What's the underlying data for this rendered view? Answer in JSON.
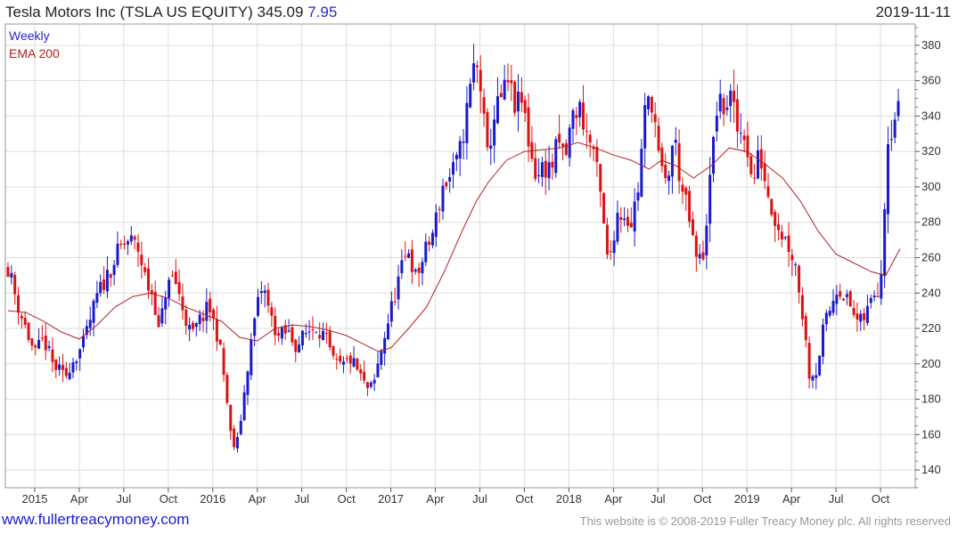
{
  "header": {
    "title": "Tesla Motors Inc (TSLA US EQUITY) 345.09",
    "change": "7.95",
    "date": "2019-11-11"
  },
  "footer": {
    "link": "www.fullertreacymoney.com",
    "copyright": "This website is © 2008-2019 Fuller Treacy Money plc. All rights reserved"
  },
  "chart_data": {
    "type": "candlestick",
    "legend": [
      "Weekly",
      "EMA 200"
    ],
    "colors": {
      "up": "#1a1acc",
      "down": "#dd1111",
      "ema": "#b52020",
      "grid": "#dddddd"
    },
    "ylim": [
      130,
      392
    ],
    "y_ticks": [
      140,
      160,
      180,
      200,
      220,
      240,
      260,
      280,
      300,
      320,
      340,
      360,
      380
    ],
    "x_ticks": [
      {
        "label": "2015",
        "t": 2015.0
      },
      {
        "label": "Apr",
        "t": 2015.25
      },
      {
        "label": "Jul",
        "t": 2015.5
      },
      {
        "label": "Oct",
        "t": 2015.75
      },
      {
        "label": "2016",
        "t": 2016.0
      },
      {
        "label": "Apr",
        "t": 2016.25
      },
      {
        "label": "Jul",
        "t": 2016.5
      },
      {
        "label": "Oct",
        "t": 2016.75
      },
      {
        "label": "2017",
        "t": 2017.0
      },
      {
        "label": "Apr",
        "t": 2017.25
      },
      {
        "label": "Jul",
        "t": 2017.5
      },
      {
        "label": "Oct",
        "t": 2017.75
      },
      {
        "label": "2018",
        "t": 2018.0
      },
      {
        "label": "Apr",
        "t": 2018.25
      },
      {
        "label": "Jul",
        "t": 2018.5
      },
      {
        "label": "Oct",
        "t": 2018.75
      },
      {
        "label": "2019",
        "t": 2019.0
      },
      {
        "label": "Apr",
        "t": 2019.25
      },
      {
        "label": "Jul",
        "t": 2019.5
      },
      {
        "label": "Oct",
        "t": 2019.75
      }
    ],
    "xlim": [
      2014.85,
      2019.9
    ],
    "close_anchors": [
      [
        2014.85,
        255
      ],
      [
        2014.9,
        235
      ],
      [
        2014.95,
        220
      ],
      [
        2015.0,
        205
      ],
      [
        2015.05,
        214
      ],
      [
        2015.1,
        200
      ],
      [
        2015.17,
        192
      ],
      [
        2015.2,
        200
      ],
      [
        2015.27,
        210
      ],
      [
        2015.35,
        238
      ],
      [
        2015.43,
        255
      ],
      [
        2015.48,
        265
      ],
      [
        2015.53,
        270
      ],
      [
        2015.58,
        265
      ],
      [
        2015.63,
        245
      ],
      [
        2015.67,
        238
      ],
      [
        2015.7,
        215
      ],
      [
        2015.73,
        240
      ],
      [
        2015.78,
        250
      ],
      [
        2015.83,
        232
      ],
      [
        2015.88,
        215
      ],
      [
        2015.93,
        225
      ],
      [
        2015.98,
        232
      ],
      [
        2016.03,
        215
      ],
      [
        2016.07,
        188
      ],
      [
        2016.1,
        160
      ],
      [
        2016.13,
        150
      ],
      [
        2016.17,
        178
      ],
      [
        2016.2,
        202
      ],
      [
        2016.24,
        228
      ],
      [
        2016.28,
        245
      ],
      [
        2016.32,
        228
      ],
      [
        2016.37,
        215
      ],
      [
        2016.42,
        218
      ],
      [
        2016.47,
        210
      ],
      [
        2016.53,
        218
      ],
      [
        2016.58,
        222
      ],
      [
        2016.63,
        215
      ],
      [
        2016.68,
        200
      ],
      [
        2016.73,
        198
      ],
      [
        2016.77,
        203
      ],
      [
        2016.82,
        195
      ],
      [
        2016.86,
        186
      ],
      [
        2016.9,
        186
      ],
      [
        2016.95,
        210
      ],
      [
        2017.0,
        230
      ],
      [
        2017.05,
        250
      ],
      [
        2017.1,
        265
      ],
      [
        2017.14,
        248
      ],
      [
        2017.19,
        262
      ],
      [
        2017.24,
        275
      ],
      [
        2017.29,
        300
      ],
      [
        2017.33,
        305
      ],
      [
        2017.38,
        315
      ],
      [
        2017.43,
        345
      ],
      [
        2017.47,
        370
      ],
      [
        2017.5,
        362
      ],
      [
        2017.54,
        315
      ],
      [
        2017.58,
        340
      ],
      [
        2017.62,
        350
      ],
      [
        2017.66,
        358
      ],
      [
        2017.7,
        345
      ],
      [
        2017.74,
        348
      ],
      [
        2017.78,
        322
      ],
      [
        2017.82,
        305
      ],
      [
        2017.86,
        312
      ],
      [
        2017.9,
        310
      ],
      [
        2017.94,
        325
      ],
      [
        2017.98,
        316
      ],
      [
        2018.02,
        340
      ],
      [
        2018.06,
        345
      ],
      [
        2018.1,
        330
      ],
      [
        2018.14,
        320
      ],
      [
        2018.18,
        292
      ],
      [
        2018.22,
        255
      ],
      [
        2018.27,
        285
      ],
      [
        2018.31,
        285
      ],
      [
        2018.35,
        280
      ],
      [
        2018.39,
        300
      ],
      [
        2018.43,
        345
      ],
      [
        2018.47,
        350
      ],
      [
        2018.51,
        310
      ],
      [
        2018.55,
        300
      ],
      [
        2018.59,
        330
      ],
      [
        2018.63,
        300
      ],
      [
        2018.67,
        285
      ],
      [
        2018.71,
        260
      ],
      [
        2018.75,
        258
      ],
      [
        2018.79,
        300
      ],
      [
        2018.83,
        345
      ],
      [
        2018.87,
        345
      ],
      [
        2018.91,
        350
      ],
      [
        2018.95,
        330
      ],
      [
        2018.99,
        332
      ],
      [
        2019.03,
        300
      ],
      [
        2019.07,
        320
      ],
      [
        2019.11,
        300
      ],
      [
        2019.15,
        285
      ],
      [
        2019.19,
        275
      ],
      [
        2019.23,
        268
      ],
      [
        2019.27,
        258
      ],
      [
        2019.31,
        230
      ],
      [
        2019.35,
        195
      ],
      [
        2019.39,
        196
      ],
      [
        2019.43,
        220
      ],
      [
        2019.47,
        232
      ],
      [
        2019.51,
        245
      ],
      [
        2019.55,
        238
      ],
      [
        2019.59,
        230
      ],
      [
        2019.63,
        222
      ],
      [
        2019.67,
        228
      ],
      [
        2019.71,
        240
      ],
      [
        2019.75,
        245
      ],
      [
        2019.79,
        328
      ],
      [
        2019.83,
        340
      ],
      [
        2019.863,
        345
      ]
    ],
    "ema200": [
      [
        2014.85,
        230
      ],
      [
        2014.95,
        229
      ],
      [
        2015.05,
        224
      ],
      [
        2015.15,
        218
      ],
      [
        2015.25,
        214
      ],
      [
        2015.35,
        222
      ],
      [
        2015.45,
        232
      ],
      [
        2015.55,
        238
      ],
      [
        2015.65,
        240
      ],
      [
        2015.75,
        237
      ],
      [
        2015.85,
        232
      ],
      [
        2015.95,
        228
      ],
      [
        2016.05,
        224
      ],
      [
        2016.15,
        215
      ],
      [
        2016.25,
        213
      ],
      [
        2016.35,
        220
      ],
      [
        2016.45,
        222
      ],
      [
        2016.55,
        221
      ],
      [
        2016.65,
        219
      ],
      [
        2016.75,
        216
      ],
      [
        2016.85,
        211
      ],
      [
        2016.93,
        207
      ],
      [
        2017.0,
        209
      ],
      [
        2017.1,
        220
      ],
      [
        2017.2,
        232
      ],
      [
        2017.3,
        252
      ],
      [
        2017.4,
        275
      ],
      [
        2017.48,
        292
      ],
      [
        2017.55,
        303
      ],
      [
        2017.65,
        315
      ],
      [
        2017.75,
        320
      ],
      [
        2017.85,
        321
      ],
      [
        2017.95,
        322
      ],
      [
        2018.05,
        325
      ],
      [
        2018.15,
        322
      ],
      [
        2018.25,
        318
      ],
      [
        2018.35,
        315
      ],
      [
        2018.45,
        310
      ],
      [
        2018.52,
        315
      ],
      [
        2018.6,
        312
      ],
      [
        2018.7,
        305
      ],
      [
        2018.8,
        312
      ],
      [
        2018.9,
        322
      ],
      [
        2019.0,
        320
      ],
      [
        2019.1,
        313
      ],
      [
        2019.2,
        305
      ],
      [
        2019.3,
        292
      ],
      [
        2019.4,
        275
      ],
      [
        2019.5,
        262
      ],
      [
        2019.6,
        257
      ],
      [
        2019.7,
        252
      ],
      [
        2019.78,
        250
      ],
      [
        2019.86,
        265
      ]
    ]
  }
}
